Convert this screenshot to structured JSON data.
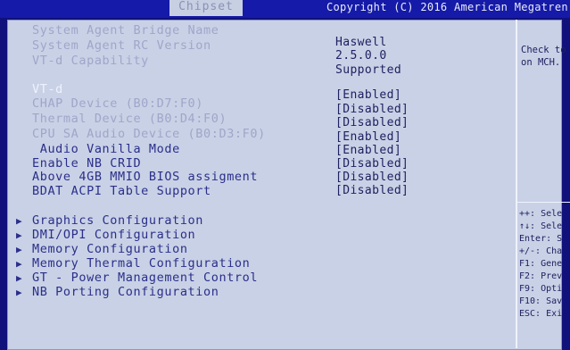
{
  "header": {
    "tab_label": "Chipset",
    "copyright": "Copyright (C) 2016 American Megatren"
  },
  "info_rows": [
    {
      "label": "System Agent Bridge Name",
      "value": "Haswell"
    },
    {
      "label": "System Agent RC Version",
      "value": "2.5.0.0"
    },
    {
      "label": "VT-d Capability",
      "value": "Supported"
    }
  ],
  "settings": [
    {
      "label": "VT-d",
      "value": "[Enabled]"
    },
    {
      "label": "CHAP Device (B0:D7:F0)",
      "value": "[Disabled]"
    },
    {
      "label": "Thermal Device (B0:D4:F0)",
      "value": "[Disabled]"
    },
    {
      "label": "CPU SA Audio Device (B0:D3:F0)",
      "value": "[Enabled]"
    },
    {
      "label": " Audio Vanilla Mode",
      "value": "[Enabled]"
    },
    {
      "label": "Enable NB CRID",
      "value": "[Disabled]"
    },
    {
      "label": "Above 4GB MMIO BIOS assigment",
      "value": "[Disabled]"
    },
    {
      "label": "BDAT ACPI Table Support",
      "value": "[Disabled]"
    }
  ],
  "submenus": [
    {
      "label": "Graphics Configuration"
    },
    {
      "label": "DMI/OPI Configuration"
    },
    {
      "label": "Memory Configuration"
    },
    {
      "label": "Memory Thermal Configuration"
    },
    {
      "label": "GT - Power Management Control"
    },
    {
      "label": "NB Porting Configuration"
    }
  ],
  "help": {
    "line1": "Check to",
    "line2": "on MCH."
  },
  "keys": [
    "++: Sele",
    "↑↓: Sele",
    "Enter: S",
    "+/-: Cha",
    "F1: Gene",
    "F2: Prev",
    "F9: Opti",
    "F10: Sav",
    "ESC: Exi"
  ],
  "colors": {
    "background": "#10117a",
    "panel": "#c9d1e6",
    "text": "#2b2f8a",
    "highlight": "#eef2ff"
  }
}
